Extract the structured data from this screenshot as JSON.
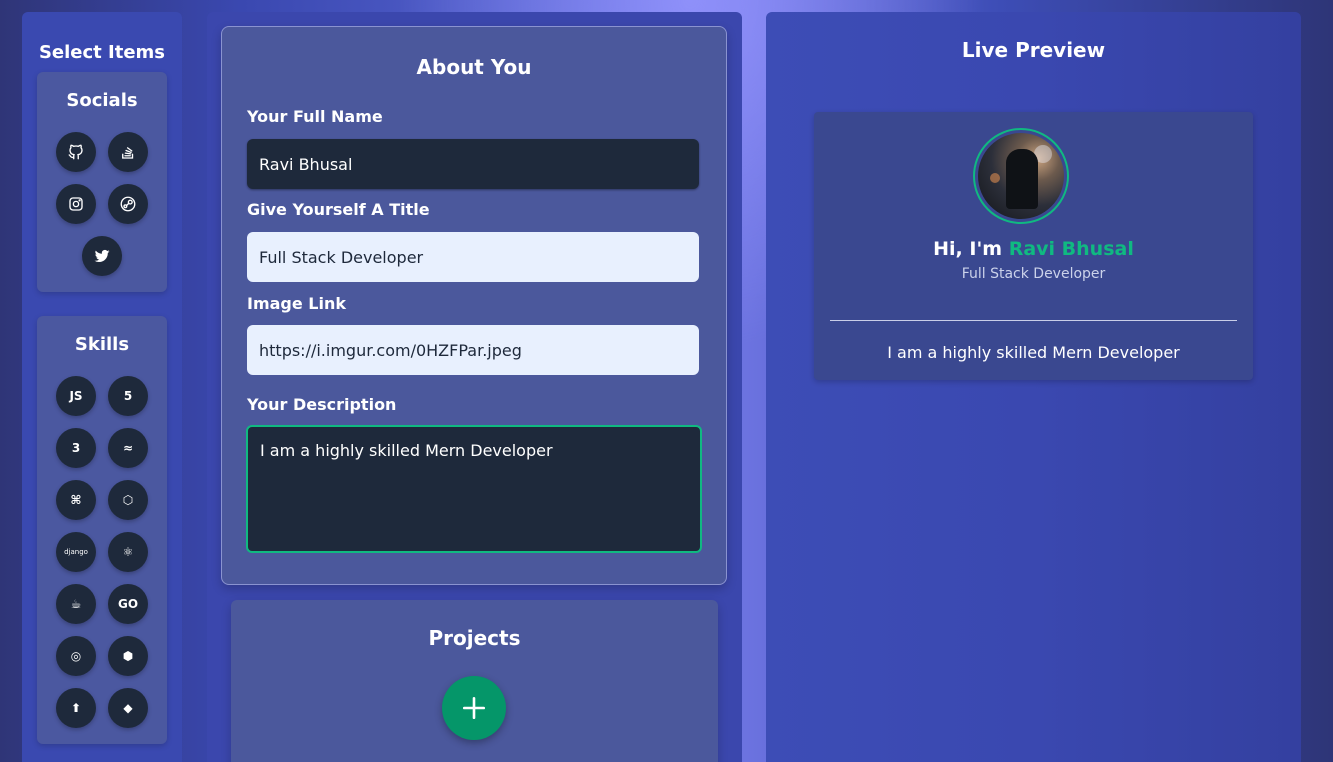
{
  "sidebar": {
    "title": "Select Items",
    "socials": {
      "title": "Socials",
      "items": [
        {
          "name": "github",
          "icon": "github-icon"
        },
        {
          "name": "stack-overflow",
          "icon": "stack-overflow-icon"
        },
        {
          "name": "instagram",
          "icon": "instagram-icon"
        },
        {
          "name": "steam",
          "icon": "steam-icon"
        },
        {
          "name": "twitter",
          "icon": "twitter-icon"
        }
      ]
    },
    "skills": {
      "title": "Skills",
      "items": [
        {
          "name": "javascript",
          "icon": "js-icon",
          "glyph": "JS"
        },
        {
          "name": "html5",
          "icon": "html5-icon",
          "glyph": "5"
        },
        {
          "name": "css3",
          "icon": "css3-icon",
          "glyph": "3"
        },
        {
          "name": "tailwind",
          "icon": "tailwind-icon",
          "glyph": "≈"
        },
        {
          "name": "python",
          "icon": "python-icon",
          "glyph": "⌘"
        },
        {
          "name": "nodejs",
          "icon": "nodejs-icon",
          "glyph": "⬡"
        },
        {
          "name": "django",
          "icon": "django-icon",
          "glyph": "django"
        },
        {
          "name": "react",
          "icon": "react-icon",
          "glyph": "⚛"
        },
        {
          "name": "java",
          "icon": "java-icon",
          "glyph": "☕"
        },
        {
          "name": "go",
          "icon": "go-icon",
          "glyph": "GO"
        },
        {
          "name": "redux",
          "icon": "redux-icon",
          "glyph": "◎"
        },
        {
          "name": "nestjs",
          "icon": "nestjs-icon",
          "glyph": "⬢"
        },
        {
          "name": "arrow",
          "icon": "arrow-up-icon",
          "glyph": "⬆"
        },
        {
          "name": "git",
          "icon": "git-icon",
          "glyph": "◆"
        }
      ]
    }
  },
  "form": {
    "title": "About You",
    "full_name": {
      "label": "Your Full Name",
      "value": "Ravi Bhusal"
    },
    "title_field": {
      "label": "Give Yourself A Title",
      "value": "Full Stack Developer"
    },
    "image": {
      "label": "Image Link",
      "value": "https://i.imgur.com/0HZFPar.jpeg"
    },
    "description": {
      "label": "Your Description",
      "value": "I am a highly skilled Mern Developer"
    }
  },
  "projects": {
    "title": "Projects",
    "add_icon": "plus-icon"
  },
  "preview": {
    "title": "Live Preview",
    "greeting_prefix": "Hi, I'm",
    "name": "Ravi Bhusal",
    "subtitle": "Full Stack Developer",
    "description": "I am a highly skilled Mern Developer"
  },
  "colors": {
    "accent": "#10b981",
    "button_dark": "#1e293b",
    "add_button": "#059669"
  }
}
